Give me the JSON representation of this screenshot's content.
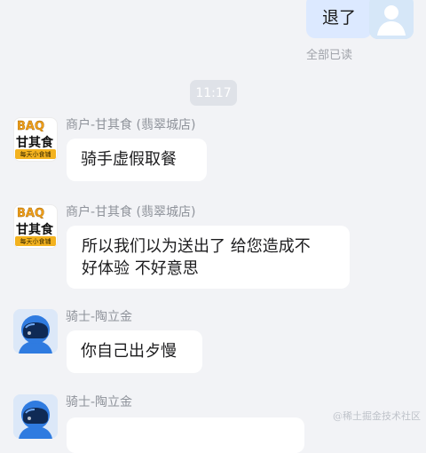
{
  "outgoing": {
    "text": "退了",
    "read_status": "全部已读"
  },
  "time_chip": "11:17",
  "messages": [
    {
      "sender": "商户-甘其食 (翡翠城店)",
      "text": "骑手虚假取餐",
      "avatar": {
        "type": "merchant",
        "logo_top": "BAQ",
        "logo_main": "甘其食",
        "logo_strip": "每天小食铺"
      }
    },
    {
      "sender": "商户-甘其食 (翡翠城店)",
      "text_lines": [
        "所以我们以为送出了 给您造成不",
        "好体验 不好意思"
      ],
      "avatar": {
        "type": "merchant",
        "logo_top": "BAQ",
        "logo_main": "甘其食",
        "logo_strip": "每天小食铺"
      }
    },
    {
      "sender": "骑士-陶立金",
      "text": "你自己出歺慢",
      "avatar": {
        "type": "rider"
      }
    },
    {
      "sender": "骑士-陶立金",
      "text": "",
      "avatar": {
        "type": "rider"
      }
    }
  ],
  "watermark": "@稀土掘金技术社区",
  "colors": {
    "background": "#F2F3F6",
    "outgoing_bubble": "#DCE9FF",
    "incoming_bubble": "#FFFFFF",
    "rider_helmet": "#2F7BE0",
    "merchant_accent": "#F3B21F"
  }
}
